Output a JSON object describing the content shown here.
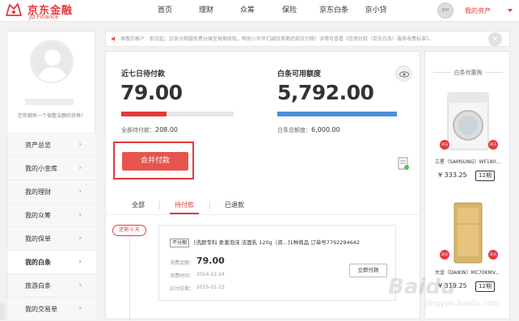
{
  "header": {
    "logo_cn": "京东金融",
    "logo_en": "JD Finance",
    "nav": [
      "首页",
      "理财",
      "众筹",
      "保险",
      "京东白条",
      "京小贷"
    ],
    "avatar_text": "JDH",
    "asset_link": "我的资产"
  },
  "sidebar": {
    "tip": "您你拥有一个很整洁静的资格！",
    "menu": [
      {
        "label": "资产总览",
        "arrow": "›"
      },
      {
        "label": "我的小金库",
        "arrow": "›"
      },
      {
        "label": "我的理财",
        "arrow": "›"
      },
      {
        "label": "我的众筹",
        "arrow": "›"
      },
      {
        "label": "我的保单",
        "arrow": "›"
      },
      {
        "label": "我的白条",
        "arrow": "›"
      },
      {
        "label": "旅游白条",
        "arrow": "›"
      },
      {
        "label": "我的交易单",
        "arrow": "›"
      }
    ]
  },
  "notice": {
    "text": "尊敬的客户：即日起，白条分期服务费分摊至每期收取，帮助小伙伴们减轻首期还款压力哦！详情可查看《信用付款（京东白条）服务收费标准》。",
    "close": "×"
  },
  "main": {
    "due7": {
      "title": "近七日待付款",
      "amount": "79.00",
      "ratio": 0.4,
      "total_label": "全部待付款：",
      "total_value": "208.00"
    },
    "credit": {
      "title": "白条可用额度",
      "amount": "5,792.00",
      "ratio": 1.0,
      "total_label": "白条总额度：",
      "total_value": "6,000.00"
    },
    "pay_button": "合并付款",
    "tabs": [
      "全部",
      "待付款",
      "已退款"
    ],
    "date_tag": "还剩 0 天",
    "card": {
      "tag": "不分期",
      "title": "[洗颜专科 柔澈泡沫 洁面乳 120g（资...]1种商品 订单号7792294642",
      "amount_label": "消费金额：",
      "amount": "79.00",
      "time_label": "消费时间：",
      "time": "2014-12-24",
      "due_label": "应付日期：",
      "due": "2015-01-23",
      "pay_now": "立即付款"
    }
  },
  "promo": {
    "title": "白条优惠购",
    "products": [
      {
        "name": "三星（SAMSUNG）WF180...",
        "price": "¥ 333.25",
        "term": "12期",
        "badge": "30天"
      },
      {
        "name": "大金（DAIKIN）MC70KMV...",
        "price": "¥ 319.25",
        "term": "12期",
        "badge": "30天"
      }
    ]
  },
  "watermark": {
    "text": "Baidu",
    "sub": "jingyan.baidu.com"
  },
  "colors": {
    "brand": "#e4393c",
    "button": "#e8544e",
    "credit_bar": "#4a90d9"
  }
}
